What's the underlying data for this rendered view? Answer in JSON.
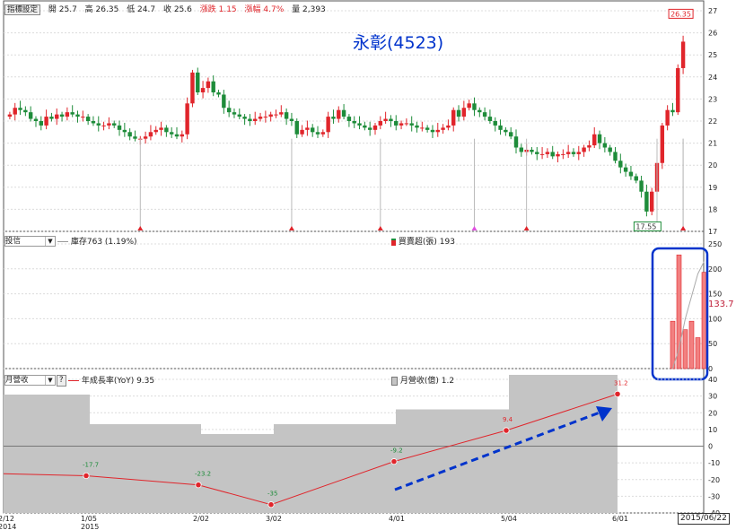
{
  "stock": {
    "title": "永彰(4523)"
  },
  "quote_bar": {
    "button": "指標設定",
    "open": "開 25.7",
    "high": "高 26.35",
    "low": "低 24.7",
    "close": "收 25.6",
    "change": "漲跌 1.15",
    "change_pct": "漲幅 4.7%",
    "volume": "量 2,393"
  },
  "trust_bar": {
    "select": "投信",
    "inventory_legend": "庫存763 (1.19%)",
    "netbuy_legend": "買賣超(張) 193",
    "side_value": "133.7"
  },
  "revenue_bar": {
    "select": "月營收",
    "help": "?",
    "yoy_legend": "年成長率(YoY) 9.35",
    "rev_legend": "月營收(億) 1.2"
  },
  "date_stamp": "2015/06/22",
  "colors": {
    "up": "#e0252b",
    "down": "#1e8c3a",
    "annot": "#0033cc",
    "magenta": "#e050e0",
    "rev_fill": "#c4c4c4"
  },
  "chart_data": [
    {
      "type": "candlestick",
      "title": "永彰(4523)",
      "ylim": [
        17,
        27
      ],
      "yticks": [
        17,
        18,
        19,
        20,
        21,
        22,
        23,
        24,
        25,
        26,
        27
      ],
      "last_price_label": "26.35",
      "low_label": "17.55",
      "closes": [
        22.3,
        22.6,
        22.5,
        22.4,
        22.1,
        22.0,
        21.8,
        22.2,
        22.1,
        22.3,
        22.2,
        22.4,
        22.3,
        22.2,
        22.2,
        22.0,
        21.9,
        21.8,
        21.8,
        21.9,
        21.8,
        21.6,
        21.5,
        21.3,
        21.2,
        21.2,
        21.3,
        21.5,
        21.6,
        21.7,
        21.5,
        21.4,
        21.3,
        21.4,
        22.8,
        24.2,
        23.3,
        23.5,
        23.8,
        23.3,
        23.2,
        22.6,
        22.4,
        22.3,
        22.2,
        22.1,
        22.0,
        22.1,
        22.2,
        22.2,
        22.3,
        22.3,
        22.4,
        22.1,
        22.0,
        21.4,
        21.6,
        21.7,
        21.5,
        21.4,
        21.5,
        22.2,
        22.1,
        22.5,
        22.2,
        22.0,
        21.9,
        21.8,
        21.7,
        21.6,
        21.8,
        22.0,
        22.1,
        22.0,
        21.8,
        21.9,
        21.9,
        21.8,
        21.7,
        21.7,
        21.6,
        21.5,
        21.6,
        21.7,
        21.8,
        22.5,
        22.2,
        22.6,
        22.8,
        22.5,
        22.4,
        22.2,
        22.0,
        21.8,
        21.6,
        21.5,
        21.3,
        20.8,
        20.6,
        20.7,
        20.6,
        20.5,
        20.5,
        20.6,
        20.4,
        20.5,
        20.5,
        20.6,
        20.5,
        20.6,
        20.8,
        20.9,
        21.4,
        21.0,
        20.8,
        20.6,
        20.2,
        19.9,
        19.7,
        19.5,
        19.3,
        18.8,
        17.9,
        18.8,
        20.1,
        21.8,
        22.5,
        22.4,
        24.4,
        25.6
      ],
      "markers": [
        {
          "date_index": 25,
          "color": "#e0252b"
        },
        {
          "date_index": 54,
          "color": "#e0252b"
        },
        {
          "date_index": 71,
          "color": "#e0252b"
        },
        {
          "date_index": 89,
          "color": "#e050e0"
        },
        {
          "date_index": 99,
          "color": "#e0252b"
        },
        {
          "date_index": 124,
          "color": "#e0252b"
        },
        {
          "date_index": 129,
          "color": "#e050e0"
        },
        {
          "date_index": 153,
          "color": "#e0252b"
        }
      ]
    },
    {
      "type": "bar",
      "title": "投信",
      "ylim": [
        0,
        250
      ],
      "yticks": [
        0,
        50,
        100,
        150,
        200,
        250
      ],
      "series": [
        {
          "name": "買賣超(張)",
          "values": [
            95,
            228,
            78,
            95,
            62,
            193
          ]
        },
        {
          "name": "庫存",
          "values": [
            0,
            40,
            100,
            145,
            190,
            215
          ]
        }
      ]
    },
    {
      "type": "line",
      "title": "月營收",
      "ylim": [
        -40,
        40
      ],
      "yticks": [
        -40,
        -30,
        -20,
        -10,
        0,
        10,
        20,
        30,
        40
      ],
      "x": [
        "2014/12",
        "2015/01",
        "2015/02",
        "2015/03",
        "2015/04",
        "2015/05",
        "2015/06"
      ],
      "x_tick_labels": [
        "2/12\n2014",
        "1/05\n2015",
        "2/02",
        "3/02",
        "4/01",
        "5/04",
        "6/01"
      ],
      "series": [
        {
          "name": "年成長率(YoY)",
          "values": [
            null,
            -17.7,
            -23.2,
            -35,
            -9.2,
            9.4,
            31.2
          ],
          "point_labels": [
            "",
            "-17.7",
            "-23.2",
            "-35",
            "-9.2",
            "9.4",
            "31.2"
          ]
        },
        {
          "name": "月營收(億)",
          "values": [
            1.2,
            0.9,
            0.8,
            0.9,
            1.05,
            1.4,
            null
          ]
        }
      ]
    }
  ]
}
